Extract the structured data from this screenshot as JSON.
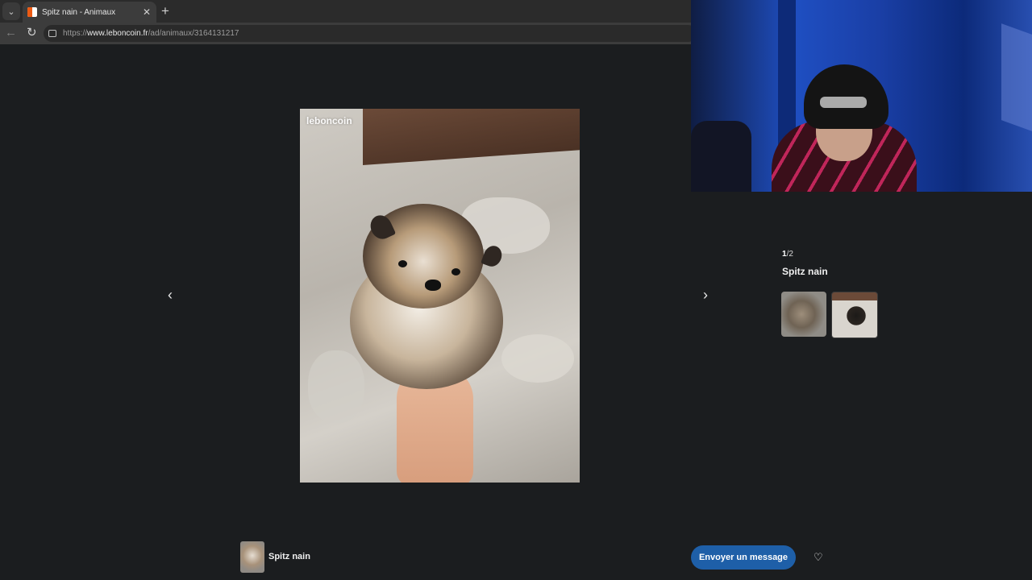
{
  "browser": {
    "tab_title": "Spitz nain - Animaux",
    "tab_list_icon": "chevron-down-icon",
    "close_icon": "close-icon",
    "new_tab_icon": "plus-icon",
    "url_scheme": "https://",
    "url_host": "www.leboncoin.fr",
    "url_path": "/ad/animaux/3164131217",
    "favicon_colors": [
      "#ec5a13",
      "#ffffff"
    ]
  },
  "viewer": {
    "watermark": "leboncoin",
    "prev_icon": "chevron-left-icon",
    "next_icon": "chevron-right-icon",
    "counter_current": "1",
    "counter_total": "/2",
    "title": "Spitz nain",
    "thumbnails": [
      {
        "alt": "Spitz nain photo 1",
        "active": false
      },
      {
        "alt": "Spitz nain photo 2",
        "active": true
      }
    ]
  },
  "bottom_bar": {
    "title": "Spitz nain",
    "message_button": "Envoyer un message",
    "favorite_icon": "heart-icon"
  },
  "colors": {
    "accent": "#1e5fa8",
    "background": "#1b1d1f",
    "brand": "#ec5a13"
  }
}
